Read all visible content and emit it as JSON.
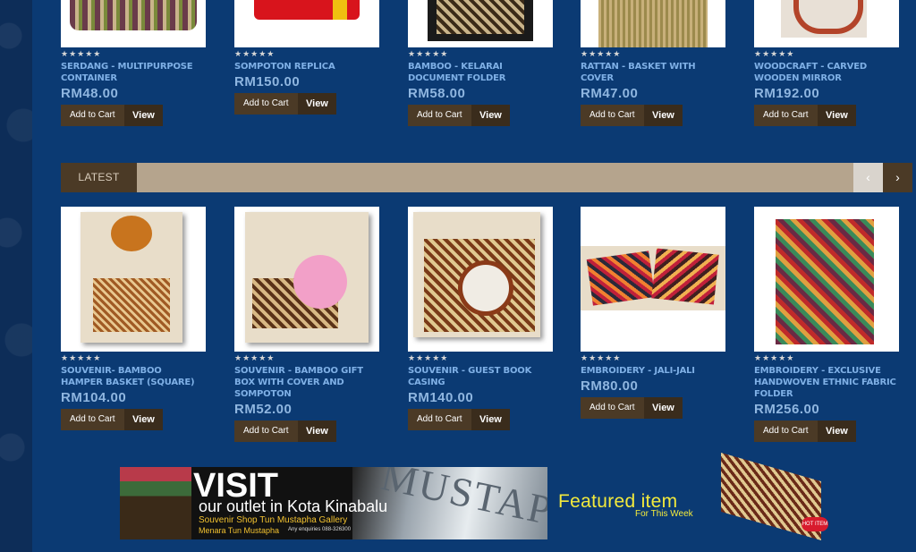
{
  "top_products": [
    {
      "stars": "★★★★★",
      "name": "SERDANG - MULTIPURPOSE CONTAINER",
      "price": "RM48.00",
      "cart": "Add to Cart",
      "view": "View"
    },
    {
      "stars": "★★★★★",
      "name": "SOMPOTON REPLICA",
      "price": "RM150.00",
      "cart": "Add to Cart",
      "view": "View"
    },
    {
      "stars": "★★★★★",
      "name": "BAMBOO - KELARAI DOCUMENT FOLDER",
      "price": "RM58.00",
      "cart": "Add to Cart",
      "view": "View"
    },
    {
      "stars": "★★★★★",
      "name": "RATTAN - BASKET WITH COVER",
      "price": "RM47.00",
      "cart": "Add to Cart",
      "view": "View"
    },
    {
      "stars": "★★★★★",
      "name": "WOODCRAFT - CARVED WOODEN MIRROR",
      "price": "RM192.00",
      "cart": "Add to Cart",
      "view": "View"
    }
  ],
  "latest": {
    "label": "LATEST",
    "prev_icon": "chevron-left-icon",
    "next_icon": "chevron-right-icon"
  },
  "latest_products": [
    {
      "stars": "★★★★★",
      "name": "SOUVENIR- BAMBOO HAMPER BASKET (SQUARE)",
      "price": "RM104.00",
      "cart": "Add to Cart",
      "view": "View"
    },
    {
      "stars": "★★★★★",
      "name": "SOUVENIR - BAMBOO GIFT BOX WITH COVER AND SOMPOTON",
      "price": "RM52.00",
      "cart": "Add to Cart",
      "view": "View"
    },
    {
      "stars": "★★★★★",
      "name": "SOUVENIR - GUEST BOOK CASING",
      "price": "RM140.00",
      "cart": "Add to Cart",
      "view": "View"
    },
    {
      "stars": "★★★★★",
      "name": "EMBROIDERY - JALI-JALI",
      "price": "RM80.00",
      "cart": "Add to Cart",
      "view": "View"
    },
    {
      "stars": "★★★★★",
      "name": "EMBROIDERY - EXCLUSIVE HANDWOVEN ETHNIC FABRIC FOLDER",
      "price": "RM256.00",
      "cart": "Add to Cart",
      "view": "View"
    }
  ],
  "banner": {
    "visit": "VISIT",
    "outlet": "our outlet in Kota Kinabalu",
    "shop": "Souvenir Shop Tun Mustapha Gallery",
    "menara": "Menara Tun Mustapha",
    "enquiries": "Any enquiries 088-326300",
    "deco_text": "MUSTAPHA"
  },
  "featured": {
    "title": "Featured item",
    "subtitle": "For This Week",
    "badge": "HOT ITEM"
  },
  "colors": {
    "background": "#0b3a73",
    "button_dark": "#4b3a26",
    "latest_bar": "#b5a48d",
    "product_name": "#7fb0e6",
    "price": "#8fb6e0",
    "featured_text": "#f3ea3c"
  }
}
